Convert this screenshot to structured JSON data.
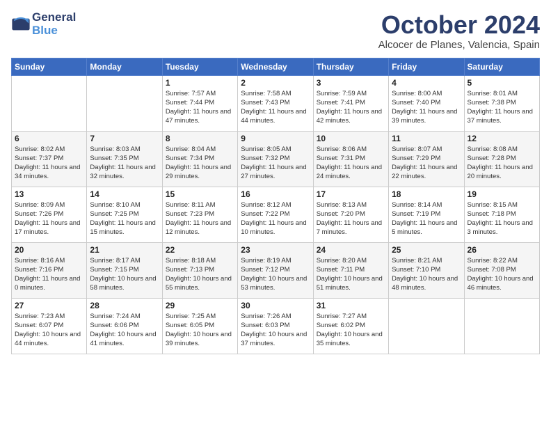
{
  "header": {
    "logo_line1": "General",
    "logo_line2": "Blue",
    "month": "October 2024",
    "location": "Alcocer de Planes, Valencia, Spain"
  },
  "weekdays": [
    "Sunday",
    "Monday",
    "Tuesday",
    "Wednesday",
    "Thursday",
    "Friday",
    "Saturday"
  ],
  "weeks": [
    [
      {
        "day": null,
        "info": null
      },
      {
        "day": null,
        "info": null
      },
      {
        "day": "1",
        "info": "Sunrise: 7:57 AM\nSunset: 7:44 PM\nDaylight: 11 hours and 47 minutes."
      },
      {
        "day": "2",
        "info": "Sunrise: 7:58 AM\nSunset: 7:43 PM\nDaylight: 11 hours and 44 minutes."
      },
      {
        "day": "3",
        "info": "Sunrise: 7:59 AM\nSunset: 7:41 PM\nDaylight: 11 hours and 42 minutes."
      },
      {
        "day": "4",
        "info": "Sunrise: 8:00 AM\nSunset: 7:40 PM\nDaylight: 11 hours and 39 minutes."
      },
      {
        "day": "5",
        "info": "Sunrise: 8:01 AM\nSunset: 7:38 PM\nDaylight: 11 hours and 37 minutes."
      }
    ],
    [
      {
        "day": "6",
        "info": "Sunrise: 8:02 AM\nSunset: 7:37 PM\nDaylight: 11 hours and 34 minutes."
      },
      {
        "day": "7",
        "info": "Sunrise: 8:03 AM\nSunset: 7:35 PM\nDaylight: 11 hours and 32 minutes."
      },
      {
        "day": "8",
        "info": "Sunrise: 8:04 AM\nSunset: 7:34 PM\nDaylight: 11 hours and 29 minutes."
      },
      {
        "day": "9",
        "info": "Sunrise: 8:05 AM\nSunset: 7:32 PM\nDaylight: 11 hours and 27 minutes."
      },
      {
        "day": "10",
        "info": "Sunrise: 8:06 AM\nSunset: 7:31 PM\nDaylight: 11 hours and 24 minutes."
      },
      {
        "day": "11",
        "info": "Sunrise: 8:07 AM\nSunset: 7:29 PM\nDaylight: 11 hours and 22 minutes."
      },
      {
        "day": "12",
        "info": "Sunrise: 8:08 AM\nSunset: 7:28 PM\nDaylight: 11 hours and 20 minutes."
      }
    ],
    [
      {
        "day": "13",
        "info": "Sunrise: 8:09 AM\nSunset: 7:26 PM\nDaylight: 11 hours and 17 minutes."
      },
      {
        "day": "14",
        "info": "Sunrise: 8:10 AM\nSunset: 7:25 PM\nDaylight: 11 hours and 15 minutes."
      },
      {
        "day": "15",
        "info": "Sunrise: 8:11 AM\nSunset: 7:23 PM\nDaylight: 11 hours and 12 minutes."
      },
      {
        "day": "16",
        "info": "Sunrise: 8:12 AM\nSunset: 7:22 PM\nDaylight: 11 hours and 10 minutes."
      },
      {
        "day": "17",
        "info": "Sunrise: 8:13 AM\nSunset: 7:20 PM\nDaylight: 11 hours and 7 minutes."
      },
      {
        "day": "18",
        "info": "Sunrise: 8:14 AM\nSunset: 7:19 PM\nDaylight: 11 hours and 5 minutes."
      },
      {
        "day": "19",
        "info": "Sunrise: 8:15 AM\nSunset: 7:18 PM\nDaylight: 11 hours and 3 minutes."
      }
    ],
    [
      {
        "day": "20",
        "info": "Sunrise: 8:16 AM\nSunset: 7:16 PM\nDaylight: 11 hours and 0 minutes."
      },
      {
        "day": "21",
        "info": "Sunrise: 8:17 AM\nSunset: 7:15 PM\nDaylight: 10 hours and 58 minutes."
      },
      {
        "day": "22",
        "info": "Sunrise: 8:18 AM\nSunset: 7:13 PM\nDaylight: 10 hours and 55 minutes."
      },
      {
        "day": "23",
        "info": "Sunrise: 8:19 AM\nSunset: 7:12 PM\nDaylight: 10 hours and 53 minutes."
      },
      {
        "day": "24",
        "info": "Sunrise: 8:20 AM\nSunset: 7:11 PM\nDaylight: 10 hours and 51 minutes."
      },
      {
        "day": "25",
        "info": "Sunrise: 8:21 AM\nSunset: 7:10 PM\nDaylight: 10 hours and 48 minutes."
      },
      {
        "day": "26",
        "info": "Sunrise: 8:22 AM\nSunset: 7:08 PM\nDaylight: 10 hours and 46 minutes."
      }
    ],
    [
      {
        "day": "27",
        "info": "Sunrise: 7:23 AM\nSunset: 6:07 PM\nDaylight: 10 hours and 44 minutes."
      },
      {
        "day": "28",
        "info": "Sunrise: 7:24 AM\nSunset: 6:06 PM\nDaylight: 10 hours and 41 minutes."
      },
      {
        "day": "29",
        "info": "Sunrise: 7:25 AM\nSunset: 6:05 PM\nDaylight: 10 hours and 39 minutes."
      },
      {
        "day": "30",
        "info": "Sunrise: 7:26 AM\nSunset: 6:03 PM\nDaylight: 10 hours and 37 minutes."
      },
      {
        "day": "31",
        "info": "Sunrise: 7:27 AM\nSunset: 6:02 PM\nDaylight: 10 hours and 35 minutes."
      },
      {
        "day": null,
        "info": null
      },
      {
        "day": null,
        "info": null
      }
    ]
  ]
}
